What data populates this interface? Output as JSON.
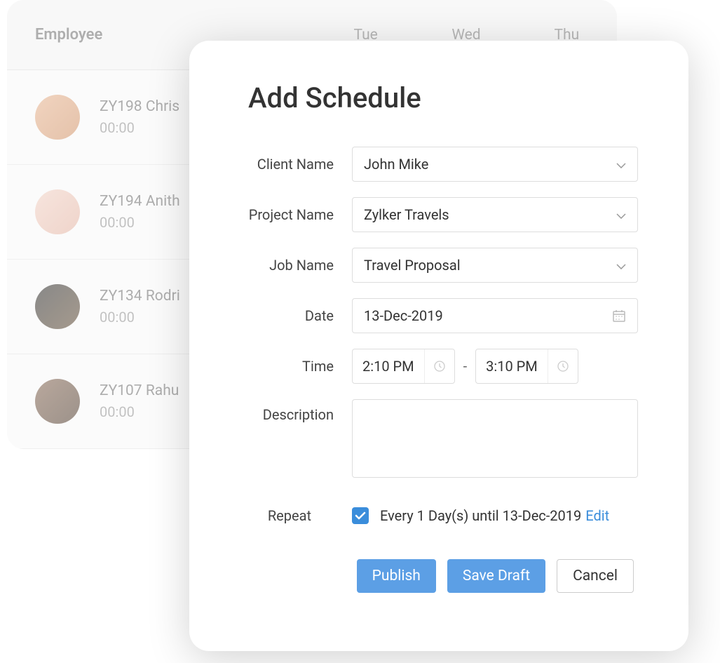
{
  "background": {
    "header_label": "Employee",
    "days": [
      "Tue",
      "Wed",
      "Thu"
    ],
    "employees": [
      {
        "id": "ZY198",
        "name": "Chris",
        "time": "00:00",
        "avatar_bg": "linear-gradient(135deg,#e8b896,#d49a72)"
      },
      {
        "id": "ZY194",
        "name": "Anith",
        "time": "00:00",
        "avatar_bg": "linear-gradient(135deg,#f2d4c8,#e5b8a8)"
      },
      {
        "id": "ZY134",
        "name": "Rodri",
        "time": "00:00",
        "avatar_bg": "linear-gradient(135deg,#3a3a3a,#6b5842)"
      },
      {
        "id": "ZY107",
        "name": "Rahu",
        "time": "00:00",
        "avatar_bg": "linear-gradient(135deg,#8b6f5c,#5c4a3d)"
      }
    ]
  },
  "modal": {
    "title": "Add Schedule",
    "labels": {
      "client_name": "Client Name",
      "project_name": "Project Name",
      "job_name": "Job Name",
      "date": "Date",
      "time": "Time",
      "description": "Description",
      "repeat": "Repeat"
    },
    "values": {
      "client_name": "John Mike",
      "project_name": "Zylker Travels",
      "job_name": "Travel Proposal",
      "date": "13-Dec-2019",
      "time_start": "2:10 PM",
      "time_end": "3:10 PM",
      "time_separator": "-",
      "description": ""
    },
    "repeat": {
      "checked": true,
      "text": "Every 1 Day(s) until 13-Dec-2019",
      "edit_label": "Edit"
    },
    "buttons": {
      "publish": "Publish",
      "save_draft": "Save Draft",
      "cancel": "Cancel"
    }
  }
}
